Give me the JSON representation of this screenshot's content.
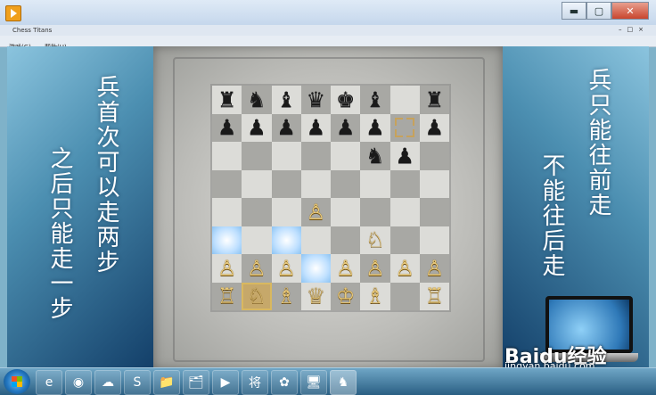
{
  "window": {
    "title": "Chess Titans",
    "buttons": {
      "minimize": "▬",
      "maximize": "▢",
      "close": "✕"
    },
    "inner_controls": "–□×"
  },
  "menu": {
    "items": [
      "游戏(G)",
      "帮助(H)"
    ]
  },
  "left_panel": {
    "col1": "兵首次可以走两步",
    "col2": "之后只能走一步"
  },
  "right_panel": {
    "col1": "兵只能往前走",
    "col2": "不能往后走"
  },
  "board": {
    "rows": [
      [
        "♜",
        "♞",
        "♝",
        "♛",
        "♚",
        "♝",
        "",
        "♜"
      ],
      [
        "♟",
        "♟",
        "♟",
        "♟",
        "♟",
        "♟",
        "",
        "♟"
      ],
      [
        "",
        "",
        "",
        "",
        "",
        "♞",
        "♟",
        ""
      ],
      [
        "",
        "",
        "",
        "",
        "",
        "",
        "",
        ""
      ],
      [
        "",
        "",
        "",
        "♙",
        "",
        "",
        "",
        ""
      ],
      [
        "",
        "",
        "",
        "",
        "",
        "♘",
        "",
        ""
      ],
      [
        "♙",
        "♙",
        "♙",
        "",
        "♙",
        "♙",
        "♙",
        "♙"
      ],
      [
        "♖",
        "♘",
        "♗",
        "♕",
        "♔",
        "♗",
        "",
        "♖"
      ]
    ],
    "colors": [
      [
        "b",
        "b",
        "b",
        "b",
        "b",
        "b",
        "",
        "b"
      ],
      [
        "b",
        "b",
        "b",
        "b",
        "b",
        "b",
        "",
        "b"
      ],
      [
        "",
        "",
        "",
        "",
        "",
        "b",
        "b",
        ""
      ],
      [
        "",
        "",
        "",
        "",
        "",
        "",
        "",
        ""
      ],
      [
        "",
        "",
        "",
        "w",
        "",
        "",
        "",
        ""
      ],
      [
        "",
        "",
        "",
        "",
        "",
        "w",
        "",
        ""
      ],
      [
        "w",
        "w",
        "w",
        "",
        "w",
        "w",
        "w",
        "w"
      ],
      [
        "w",
        "w",
        "w",
        "w",
        "w",
        "w",
        "",
        "w"
      ]
    ],
    "highlighted": [
      [
        5,
        0
      ],
      [
        5,
        2
      ],
      [
        6,
        3
      ]
    ],
    "selected": [
      7,
      1
    ],
    "hint_square": [
      1,
      6
    ]
  },
  "taskbar": {
    "items": [
      "e",
      "◉",
      "☁",
      "S",
      "📁",
      "🗂",
      "▶",
      "将",
      "✿",
      "🖥",
      "♞"
    ],
    "active_index": 10
  },
  "watermark": {
    "brand": "Baidu经验",
    "url": "jingyan.baidu.com"
  }
}
